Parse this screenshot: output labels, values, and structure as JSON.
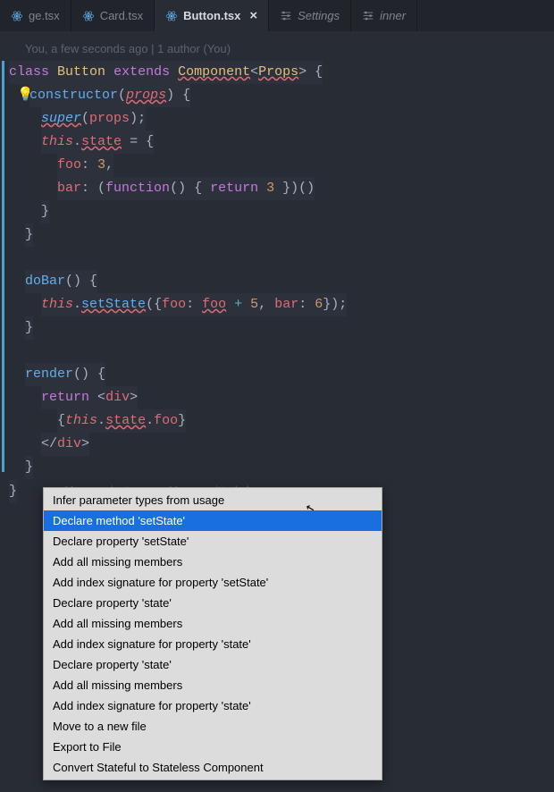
{
  "tabs": [
    {
      "label": "ge.tsx",
      "icon": "react",
      "active": false,
      "italic": false
    },
    {
      "label": "Card.tsx",
      "icon": "react",
      "active": false,
      "italic": false
    },
    {
      "label": "Button.tsx",
      "icon": "react",
      "active": true,
      "italic": false,
      "closeable": true
    },
    {
      "label": "Settings",
      "icon": "settings",
      "active": false,
      "italic": true
    },
    {
      "label": "inner",
      "icon": "settings",
      "active": false,
      "italic": true
    }
  ],
  "blame": {
    "header": "You, a few seconds ago | 1 author (You)",
    "inline": "You, a minute ago • Uncommitted changes"
  },
  "code": {
    "l1": {
      "class": "class",
      "name": "Button",
      "extends": "extends",
      "component": "Component",
      "props": "Props",
      "brace": "{"
    },
    "l2": {
      "ctor": "constructor",
      "props": "props",
      "end": ") {"
    },
    "l3": {
      "super": "super",
      "props": "props",
      "end": ");"
    },
    "l4": {
      "this": "this",
      "state": "state",
      "eq": " = {"
    },
    "l5": {
      "key": "foo",
      "val": "3",
      "comma": ","
    },
    "l6": {
      "key": "bar",
      "fn": "function",
      "ret": "return",
      "val": "3",
      "end": " })()"
    },
    "l7": {
      "brace": "}"
    },
    "l8": {
      "brace": "}"
    },
    "l10": {
      "name": "doBar",
      "end": "() {"
    },
    "l11": {
      "this": "this",
      "method": "setState",
      "foo": "foo",
      "fooVal": "foo",
      "plus": "+",
      "five": "5",
      "bar": "bar",
      "six": "6",
      "end": "});"
    },
    "l12": {
      "brace": "}"
    },
    "l14": {
      "name": "render",
      "end": "() {"
    },
    "l15": {
      "ret": "return",
      "tag": "div"
    },
    "l16": {
      "this": "this",
      "state": "state",
      "foo": "foo"
    },
    "l17": {
      "tag": "div"
    },
    "l18": {
      "brace": "}"
    },
    "l19": {
      "brace": "}"
    }
  },
  "contextMenu": {
    "items": [
      "Infer parameter types from usage",
      "Declare method 'setState'",
      "Declare property 'setState'",
      "Add all missing members",
      "Add index signature for property 'setState'",
      "Declare property 'state'",
      "Add all missing members",
      "Add index signature for property 'state'",
      "Declare property 'state'",
      "Add all missing members",
      "Add index signature for property 'state'",
      "Move to a new file",
      "Export to File",
      "Convert Stateful to Stateless Component"
    ],
    "selectedIndex": 1
  }
}
